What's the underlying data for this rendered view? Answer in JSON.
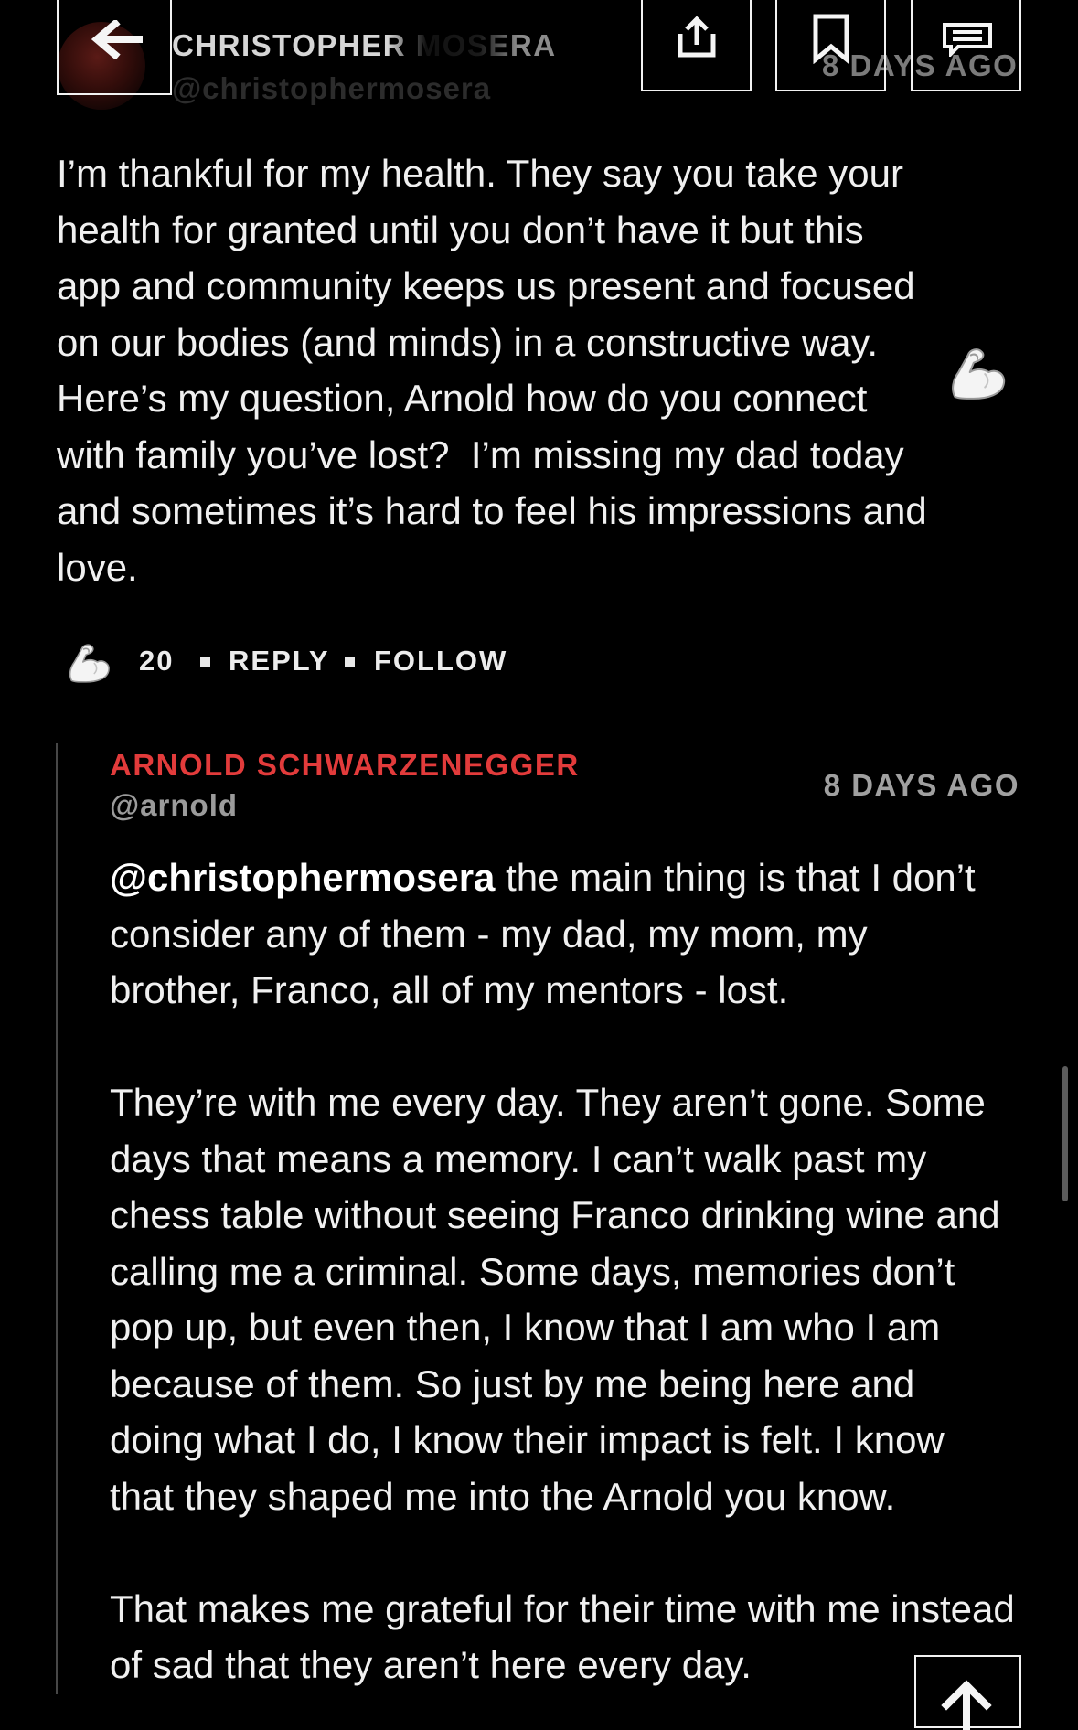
{
  "header": {
    "author_name": "CHRISTOPHER MOSERA",
    "author_handle": "@christophermosera",
    "timestamp": "8 DAYS AGO"
  },
  "icons": {
    "back": "arrow-left-icon",
    "share": "share-icon",
    "bookmark": "bookmark-icon",
    "comment": "comment-icon",
    "reaction": "flexed-biceps-icon",
    "scroll_top": "arrow-up-icon"
  },
  "post": {
    "lines": [
      "I’m thankful for my health. They say you take your",
      "health for granted until you don’t have it but this",
      "app and community keeps us present and focused",
      "on our bodies (and minds) in a constructive way.",
      "Here’s my question, Arnold how do you connect",
      "with family you’ve lost?  I’m missing my dad today",
      "and sometimes it’s hard to feel his impressions and",
      "love."
    ],
    "reaction_count": "20",
    "reply_label": "REPLY",
    "follow_label": "FOLLOW"
  },
  "reply": {
    "author_name": "ARNOLD SCHWARZENEGGER",
    "author_handle": "@arnold",
    "timestamp": "8 DAYS AGO",
    "mention": "@christophermosera",
    "lines": [
      " the main thing is that I don’t",
      "consider any of them - my dad, my mom, my",
      "brother, Franco, all of my mentors - lost.",
      "",
      "They’re with me every day. They aren’t gone. Some",
      "days that means a memory. I can’t walk past my",
      "chess table without seeing Franco drinking wine and",
      "calling me a criminal. Some days, memories don’t",
      "pop up, but even then, I know that I am who I am",
      "because of them. So just by me being here and",
      "doing what I do, I know their impact is felt. I know",
      "that they shaped me into the Arnold you know.",
      "",
      "That makes me grateful for their time with me instead",
      "of sad that they aren’t here every day."
    ]
  },
  "colors": {
    "background": "#000000",
    "text": "#f0f0f0",
    "reply_author": "#e23b3b",
    "muted": "#9b9b9b"
  }
}
